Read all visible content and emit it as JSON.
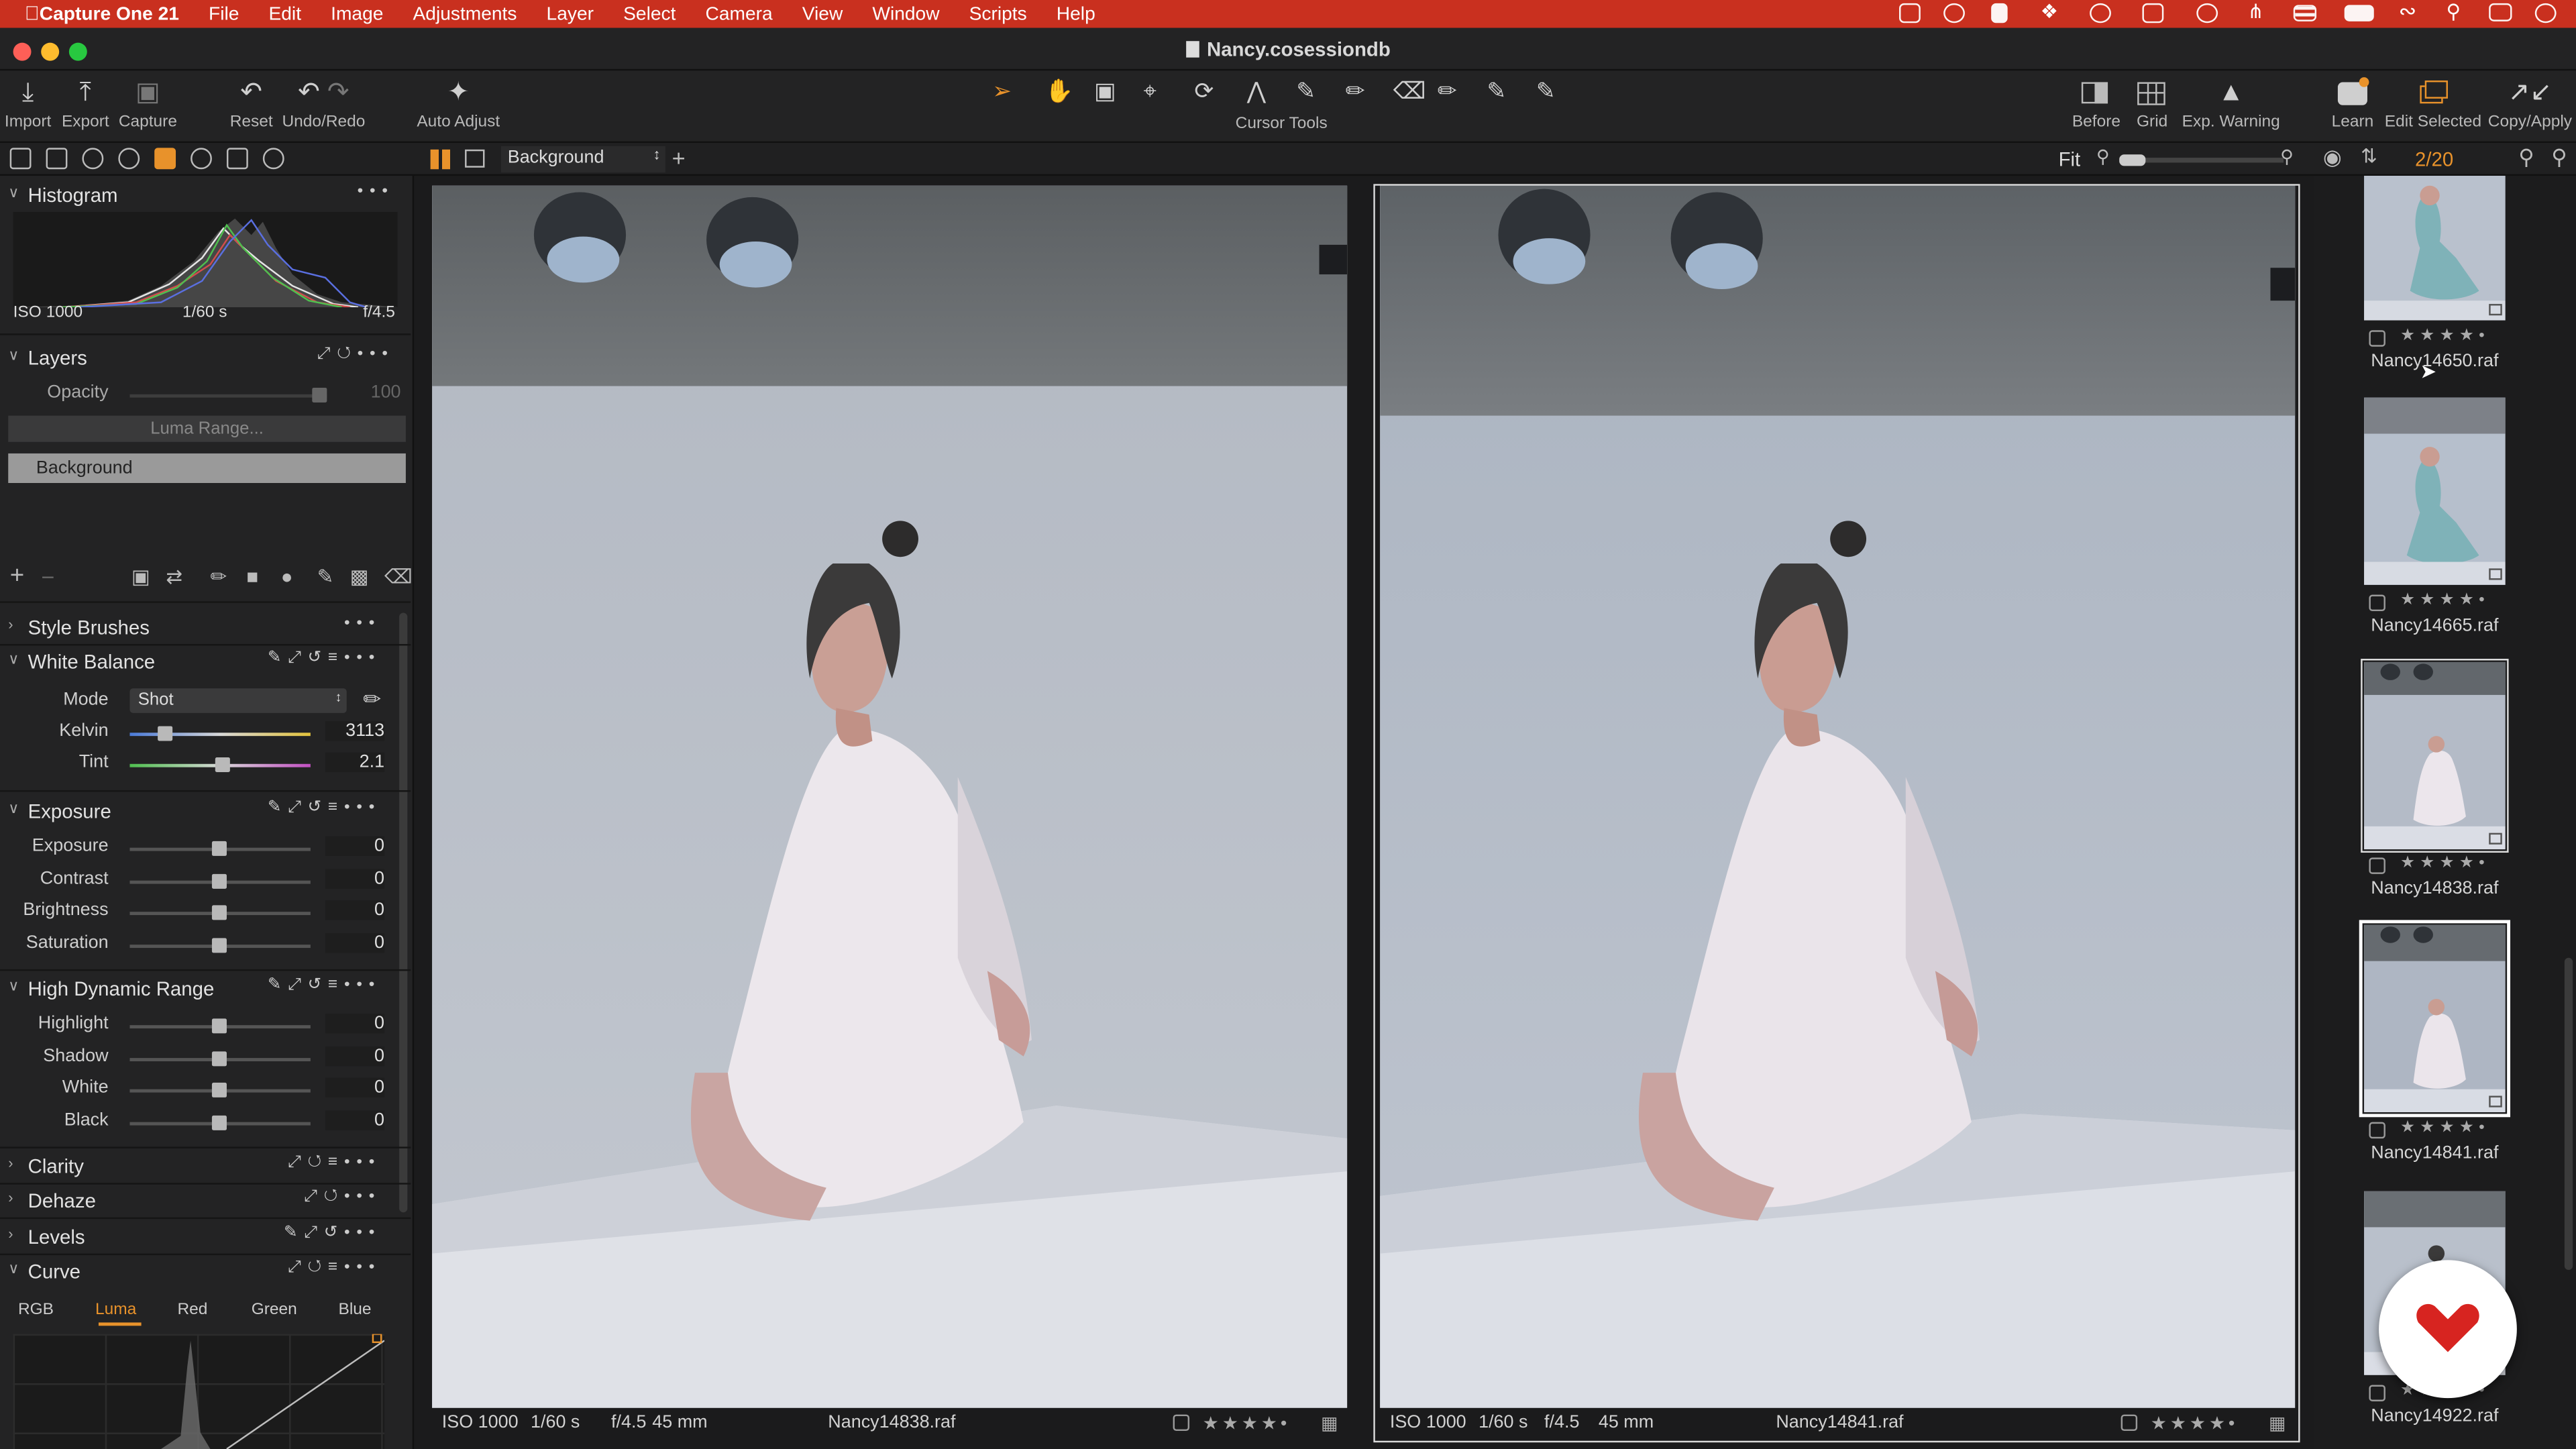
{
  "menubar": {
    "app": "Capture One 21",
    "items": [
      "File",
      "Edit",
      "Image",
      "Adjustments",
      "Layer",
      "Select",
      "Camera",
      "View",
      "Window",
      "Scripts",
      "Help"
    ]
  },
  "window": {
    "title": "Nancy.cosessiondb"
  },
  "toolbar": {
    "import": "Import",
    "export": "Export",
    "capture": "Capture",
    "reset": "Reset",
    "undo_redo": "Undo/Redo",
    "auto_adjust": "Auto Adjust",
    "cursor_tools": "Cursor Tools",
    "before": "Before",
    "grid": "Grid",
    "exp_warning": "Exp. Warning",
    "learn": "Learn",
    "edit_selected": "Edit Selected",
    "copy_apply": "Copy/Apply"
  },
  "viewer_bar": {
    "layer_select": "Background",
    "fit": "Fit",
    "counter": "2/20"
  },
  "histogram": {
    "title": "Histogram",
    "iso": "ISO 1000",
    "shutter": "1/60 s",
    "aperture": "f/4.5"
  },
  "layers": {
    "title": "Layers",
    "opacity_label": "Opacity",
    "opacity_value": "100",
    "opacity_level": 1.0,
    "luma_range": "Luma Range...",
    "background": "Background"
  },
  "style_brushes": {
    "title": "Style Brushes"
  },
  "white_balance": {
    "title": "White Balance",
    "mode_label": "Mode",
    "mode_value": "Shot",
    "kelvin_label": "Kelvin",
    "kelvin_value": "3113",
    "tint_label": "Tint",
    "tint_value": "2.1"
  },
  "exposure": {
    "title": "Exposure",
    "rows": [
      {
        "label": "Exposure",
        "value": "0"
      },
      {
        "label": "Contrast",
        "value": "0"
      },
      {
        "label": "Brightness",
        "value": "0"
      },
      {
        "label": "Saturation",
        "value": "0"
      }
    ]
  },
  "hdr": {
    "title": "High Dynamic Range",
    "rows": [
      {
        "label": "Highlight",
        "value": "0"
      },
      {
        "label": "Shadow",
        "value": "0"
      },
      {
        "label": "White",
        "value": "0"
      },
      {
        "label": "Black",
        "value": "0"
      }
    ]
  },
  "clarity": {
    "title": "Clarity"
  },
  "dehaze": {
    "title": "Dehaze"
  },
  "levels": {
    "title": "Levels"
  },
  "curve": {
    "title": "Curve",
    "tabs": [
      "RGB",
      "Luma",
      "Red",
      "Green",
      "Blue"
    ],
    "active_tab": "Luma"
  },
  "viewers": [
    {
      "iso": "ISO 1000",
      "shutter": "1/60 s",
      "aperture": "f/4.5",
      "focal": "45 mm",
      "file": "Nancy14838.raf",
      "rating": "★★★★•"
    },
    {
      "iso": "ISO 1000",
      "shutter": "1/60 s",
      "aperture": "f/4.5",
      "focal": "45 mm",
      "file": "Nancy14841.raf",
      "rating": "★★★★•"
    }
  ],
  "browser": {
    "items": [
      {
        "file": "Nancy14650.raf",
        "stars": "★★★★•"
      },
      {
        "file": "Nancy14665.raf",
        "stars": "★★★★•"
      },
      {
        "file": "Nancy14838.raf",
        "stars": "★★★★•"
      },
      {
        "file": "Nancy14841.raf",
        "stars": "★★★★•"
      },
      {
        "file": "Nancy14922.raf",
        "stars": "★★★★•"
      }
    ]
  },
  "colors": {
    "menubar": "#c9301f",
    "accent_orange": "#e8922b",
    "panel": "#232324",
    "backdrop": "#1b1b1c"
  }
}
